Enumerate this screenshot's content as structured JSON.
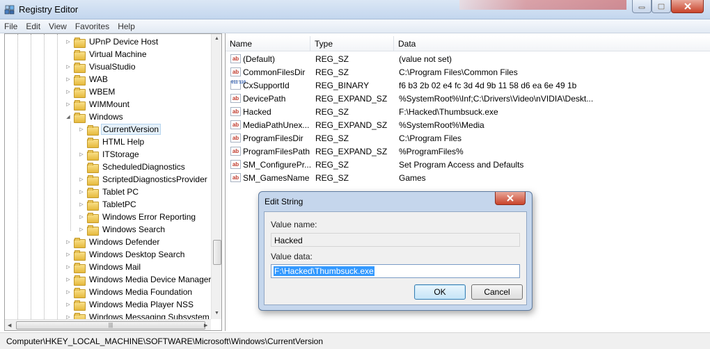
{
  "window": {
    "title": "Registry Editor"
  },
  "menu": [
    "File",
    "Edit",
    "View",
    "Favorites",
    "Help"
  ],
  "tree": {
    "items": [
      {
        "label": "UPnP Device Host",
        "expander": "collapsed"
      },
      {
        "label": "Virtual Machine",
        "expander": "none"
      },
      {
        "label": "VisualStudio",
        "expander": "collapsed"
      },
      {
        "label": "WAB",
        "expander": "collapsed"
      },
      {
        "label": "WBEM",
        "expander": "collapsed"
      },
      {
        "label": "WIMMount",
        "expander": "collapsed"
      },
      {
        "label": "Windows",
        "expander": "expanded"
      },
      {
        "label": "CurrentVersion",
        "expander": "collapsed",
        "selected": true
      },
      {
        "label": "HTML Help",
        "expander": "none"
      },
      {
        "label": "ITStorage",
        "expander": "collapsed"
      },
      {
        "label": "ScheduledDiagnostics",
        "expander": "none"
      },
      {
        "label": "ScriptedDiagnosticsProvider",
        "expander": "collapsed"
      },
      {
        "label": "Tablet PC",
        "expander": "collapsed"
      },
      {
        "label": "TabletPC",
        "expander": "collapsed"
      },
      {
        "label": "Windows Error Reporting",
        "expander": "collapsed"
      },
      {
        "label": "Windows Search",
        "expander": "collapsed"
      },
      {
        "label": "Windows Defender",
        "expander": "collapsed"
      },
      {
        "label": "Windows Desktop Search",
        "expander": "collapsed"
      },
      {
        "label": "Windows Mail",
        "expander": "collapsed"
      },
      {
        "label": "Windows Media Device Manager",
        "expander": "collapsed"
      },
      {
        "label": "Windows Media Foundation",
        "expander": "collapsed"
      },
      {
        "label": "Windows Media Player NSS",
        "expander": "collapsed"
      },
      {
        "label": "Windows Messaging Subsystem",
        "expander": "collapsed"
      }
    ]
  },
  "values": {
    "columns": [
      "Name",
      "Type",
      "Data"
    ],
    "rows": [
      {
        "name": "(Default)",
        "type": "REG_SZ",
        "data": "(value not set)",
        "icon": "string-value-icon"
      },
      {
        "name": "CommonFilesDir",
        "type": "REG_SZ",
        "data": "C:\\Program Files\\Common Files",
        "icon": "string-value-icon"
      },
      {
        "name": "CxSupportId",
        "type": "REG_BINARY",
        "data": "f6 b3 2b 02 e4 fc 3d 4d 9b 11 58 d6 ea 6e 49 1b",
        "icon": "binary-value-icon"
      },
      {
        "name": "DevicePath",
        "type": "REG_EXPAND_SZ",
        "data": "%SystemRoot%\\Inf;C:\\Drivers\\Video\\nVIDIA\\Deskt...",
        "icon": "string-value-icon"
      },
      {
        "name": "Hacked",
        "type": "REG_SZ",
        "data": "F:\\Hacked\\Thumbsuck.exe",
        "icon": "string-value-icon"
      },
      {
        "name": "MediaPathUnex...",
        "type": "REG_EXPAND_SZ",
        "data": "%SystemRoot%\\Media",
        "icon": "string-value-icon"
      },
      {
        "name": "ProgramFilesDir",
        "type": "REG_SZ",
        "data": "C:\\Program Files",
        "icon": "string-value-icon"
      },
      {
        "name": "ProgramFilesPath",
        "type": "REG_EXPAND_SZ",
        "data": "%ProgramFiles%",
        "icon": "string-value-icon"
      },
      {
        "name": "SM_ConfigurePr...",
        "type": "REG_SZ",
        "data": "Set Program Access and Defaults",
        "icon": "string-value-icon"
      },
      {
        "name": "SM_GamesName",
        "type": "REG_SZ",
        "data": "Games",
        "icon": "string-value-icon"
      }
    ]
  },
  "status": {
    "path": "Computer\\HKEY_LOCAL_MACHINE\\SOFTWARE\\Microsoft\\Windows\\CurrentVersion"
  },
  "dialog": {
    "title": "Edit String",
    "value_name_label": "Value name:",
    "value_name": "Hacked",
    "value_data_label": "Value data:",
    "value_data": "F:\\Hacked\\Thumbsuck.exe",
    "ok_label": "OK",
    "cancel_label": "Cancel"
  },
  "icons": {
    "app": "registry-editor-icon",
    "minimize": "minimize-icon",
    "maximize": "maximize-icon",
    "close": "close-icon"
  }
}
